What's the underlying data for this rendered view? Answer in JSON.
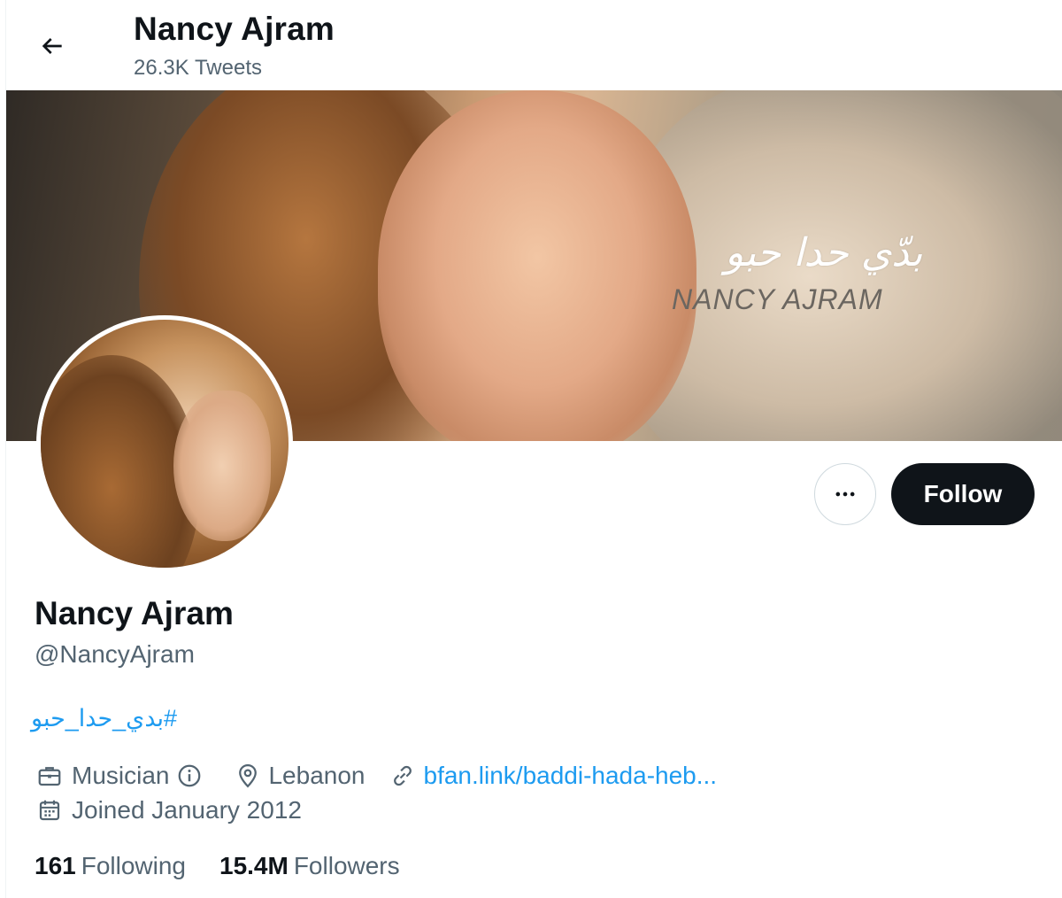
{
  "header": {
    "title": "Nancy Ajram",
    "tweet_count": "26.3K Tweets",
    "back_icon": "arrow-left-icon"
  },
  "banner": {
    "overlay_arabic": "بدّي حدا حبو",
    "overlay_name": "NANCY AJRAM"
  },
  "actions": {
    "more_icon": "more-horizontal-icon",
    "follow_label": "Follow"
  },
  "profile": {
    "name": "Nancy Ajram",
    "handle": "@NancyAjram",
    "bio_hashtag": "#بدي_حدا_حبو",
    "category": "Musician",
    "location": "Lebanon",
    "link": "bfan.link/baddi-hada-heb...",
    "joined": "Joined January 2012"
  },
  "stats": {
    "following_count": "161",
    "following_label": "Following",
    "followers_count": "15.4M",
    "followers_label": "Followers"
  },
  "colors": {
    "accent": "#1d9bf0",
    "text_primary": "#0f1419",
    "text_secondary": "#536471",
    "follow_bg": "#0f1419"
  }
}
